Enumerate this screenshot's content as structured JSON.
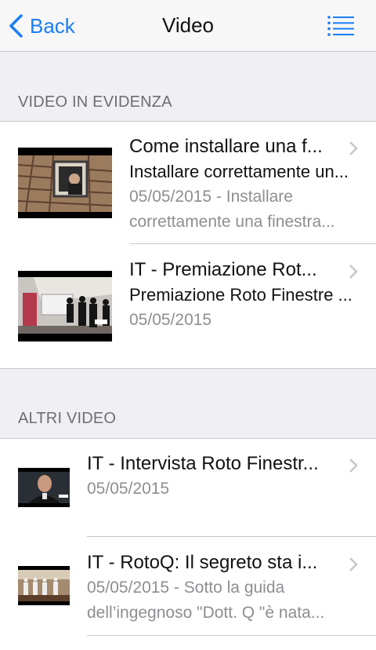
{
  "nav": {
    "back_label": "Back",
    "title": "Video",
    "menu_icon": "list-icon"
  },
  "sections": [
    {
      "header": "VIDEO IN EVIDENZA",
      "items": [
        {
          "title": "Come installare una f...",
          "subtitle": "Installare correttamente un...",
          "desc_line1": "05/05/2015 - Installare",
          "desc_line2": "correttamente una finestra..."
        },
        {
          "title": "IT - Premiazione Rot...",
          "subtitle": "Premiazione Roto Finestre ...",
          "desc_line1": "05/05/2015"
        }
      ]
    },
    {
      "header": "ALTRI VIDEO",
      "items": [
        {
          "title": "IT - Intervista Roto Finestr...",
          "desc_line1": "05/05/2015"
        },
        {
          "title": "IT - RotoQ: Il segreto sta i...",
          "desc_line1": "05/05/2015 - Sotto la guida",
          "desc_line2": "dell’ingegnoso \"Dott. Q \"è nata..."
        }
      ]
    }
  ],
  "colors": {
    "accent": "#1a7ef5",
    "secondary_text": "#8e8e93",
    "background": "#efeff4"
  }
}
